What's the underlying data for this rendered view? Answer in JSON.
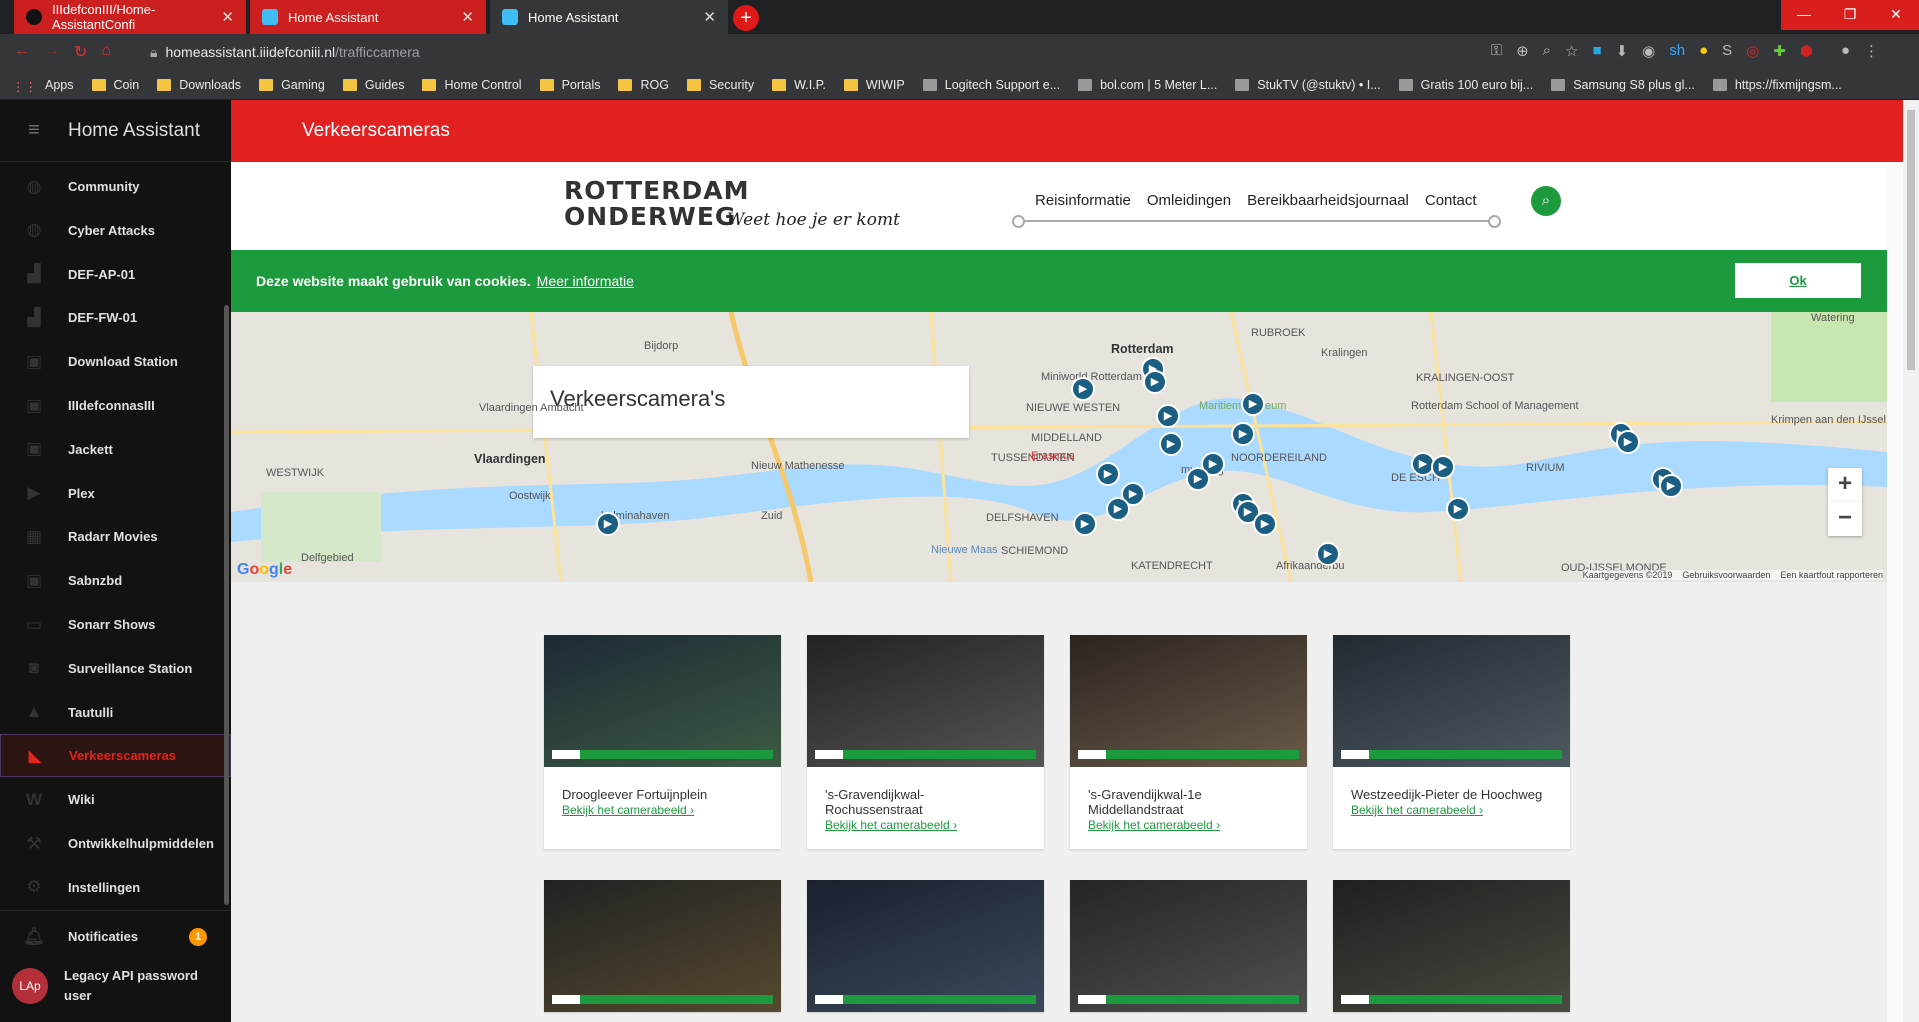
{
  "browser": {
    "tabs": [
      {
        "label": "IIIdefconIII/Home-AssistantConfi"
      },
      {
        "label": "Home Assistant"
      },
      {
        "label": "Home Assistant"
      }
    ],
    "url_host": "homeassistant.iiidefconiii.nl",
    "url_path": "/trafficcamera",
    "bookmarks": [
      "Apps",
      "Coin",
      "Downloads",
      "Gaming",
      "Guides",
      "Home Control",
      "Portals",
      "ROG",
      "Security",
      "W.I.P.",
      "WIWIP",
      "Logitech Support e...",
      "bol.com | 5 Meter L...",
      "StukTV (@stuktv) • I...",
      "Gratis 100 euro bij...",
      "Samsung S8 plus gl...",
      "https://fixmijngsm..."
    ]
  },
  "sidebar": {
    "title": "Home Assistant",
    "items": [
      {
        "label": "Community",
        "icon": "community-icon"
      },
      {
        "label": "Cyber Attacks",
        "icon": "globe-icon"
      },
      {
        "label": "DEF-AP-01",
        "icon": "router-icon"
      },
      {
        "label": "DEF-FW-01",
        "icon": "router-icon"
      },
      {
        "label": "Download Station",
        "icon": "briefcase-icon"
      },
      {
        "label": "IIIdefconnasIII",
        "icon": "briefcase-icon"
      },
      {
        "label": "Jackett",
        "icon": "briefcase-icon"
      },
      {
        "label": "Plex",
        "icon": "plex-icon"
      },
      {
        "label": "Radarr Movies",
        "icon": "film-icon"
      },
      {
        "label": "Sabnzbd",
        "icon": "briefcase-icon"
      },
      {
        "label": "Sonarr Shows",
        "icon": "tv-icon"
      },
      {
        "label": "Surveillance Station",
        "icon": "camera-icon"
      },
      {
        "label": "Tautulli",
        "icon": "chart-icon"
      },
      {
        "label": "Verkeerscameras",
        "icon": "cctv-icon"
      },
      {
        "label": "Wiki",
        "icon": "wikipedia-icon"
      },
      {
        "label": "Ontwikkelhulpmiddelen",
        "icon": "hammer-icon"
      },
      {
        "label": "Instellingen",
        "icon": "gear-icon"
      }
    ],
    "notifications_label": "Notificaties",
    "notifications_count": "1",
    "user_initials": "LAp",
    "user_name_1": "Legacy API password",
    "user_name_2": "user"
  },
  "header": {
    "title": "Verkeerscameras"
  },
  "site": {
    "logo_line1": "ROTTERDAM",
    "logo_line2": "ONDERWEG",
    "tagline": "Weet hoe je er komt",
    "nav": [
      "Reisinformatie",
      "Omleidingen",
      "Bereikbaarheidsjournaal",
      "Contact"
    ],
    "cookie_text": "Deze website maakt gebruik van cookies.",
    "cookie_link": "Meer informatie",
    "cookie_ok": "Ok"
  },
  "map": {
    "panel_title": "Verkeerscamera's",
    "labels": {
      "bijdorp": "Bijdorp",
      "miniworld": "Miniworld Rotterdam",
      "rotterdam": "Rotterdam",
      "rubroek": "RUBROEK",
      "kralingen": "Kralingen",
      "vlaardingen_ambacht": "Vlaardingen Ambacht",
      "vlaardingen": "Vlaardingen",
      "westwijk": "WESTWIJK",
      "oostwijk": "Oostwijk",
      "nieuw_mathenesse": "Nieuw Mathenesse",
      "tussendijken": "TUSSENDIJKEN",
      "middelland": "MIDDELLAND",
      "nieuwe_westen": "NIEUWE WESTEN",
      "noordereiland": "NOORDEREILAND",
      "delfshaven": "DELFSHAVEN",
      "schiemond": "SCHIEMOND",
      "katendrecht": "KATENDRECHT",
      "kralingen_oost": "KRALINGEN-OOST",
      "rotterdam_school": "Rotterdam School of Management",
      "de_esch": "DE ESCH",
      "rivium": "RIVIUM",
      "krimpen": "Krimpen aan den IJssel",
      "oud_ijsselmonde": "OUD-IJSSELMONDE",
      "watering": "Watering",
      "delfgebied": "Delfgebied",
      "zuid": "Zuid",
      "nieuwe_maas": "Nieuwe Maas",
      "erasmus": "Erasmus",
      "helminahaven": "helminahaven",
      "afrikaanderbuurt": "Afrikaanderbu",
      "maritiem": "Maritiem museum",
      "musbrug": "musbrug"
    },
    "google": "Google",
    "footer": [
      "Kaartgegevens ©2019",
      "Gebruiksvoorwaarden",
      "Een kaartfout rapporteren"
    ],
    "zoom_in": "+",
    "zoom_out": "−"
  },
  "cameras": [
    {
      "name": "Droogleever Fortuijnplein",
      "link": "Bekijk het camerabeeld ›"
    },
    {
      "name": "'s-Gravendijkwal-\nRochussenstraat",
      "link": "Bekijk het camerabeeld ›"
    },
    {
      "name": "'s-Gravendijkwal-1e\nMiddellandstraat",
      "link": "Bekijk het camerabeeld ›"
    },
    {
      "name": "Westzeedijk-Pieter de Hoochweg",
      "link": "Bekijk het camerabeeld ›"
    },
    {
      "name": "",
      "link": ""
    },
    {
      "name": "",
      "link": ""
    },
    {
      "name": "",
      "link": ""
    },
    {
      "name": "",
      "link": ""
    }
  ],
  "colors": {
    "ha_red": "#e2201f",
    "ro_green": "#1e9a3e",
    "cam_blue": "#1b5e84"
  }
}
